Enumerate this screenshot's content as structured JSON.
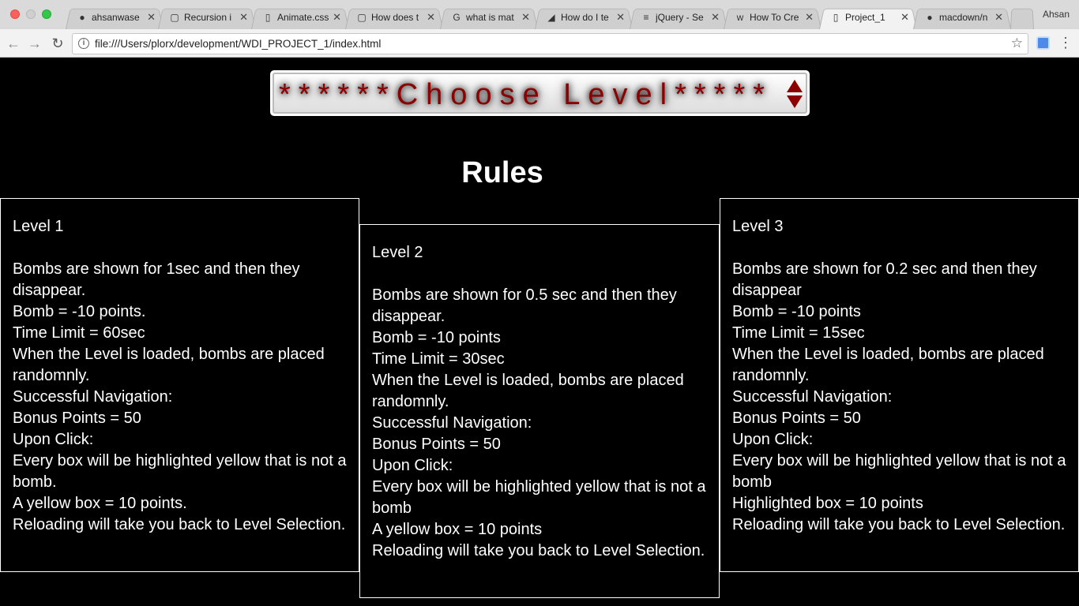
{
  "browser": {
    "tabs": [
      {
        "title": "ahsanwase",
        "icon": "github-icon"
      },
      {
        "title": "Recursion i",
        "icon": "codepen-icon"
      },
      {
        "title": "Animate.css",
        "icon": "page-icon"
      },
      {
        "title": "How does t",
        "icon": "codepen-icon"
      },
      {
        "title": "what is mat",
        "icon": "google-icon"
      },
      {
        "title": "How do I te",
        "icon": "stackexchange-icon"
      },
      {
        "title": "jQuery - Se",
        "icon": "stackoverflow-icon"
      },
      {
        "title": "How To Cre",
        "icon": "w3schools-icon"
      },
      {
        "title": "Project_1",
        "icon": "page-icon"
      },
      {
        "title": "macdown/n",
        "icon": "github-icon"
      }
    ],
    "active_tab": "Project_1",
    "user": "Ahsan",
    "url": "file:///Users/plorx/development/WDI_PROJECT_1/index.html",
    "close_glyph": "✕",
    "info_glyph": "i",
    "star_glyph": "☆",
    "menu_glyph": "⋮",
    "back_glyph": "←",
    "forward_glyph": "→",
    "reload_glyph": "↻"
  },
  "page": {
    "level_select": {
      "selected": "******Choose Level*****"
    },
    "rules_title": "Rules",
    "levels": [
      {
        "heading": "Level 1",
        "lines": [
          "Bombs are shown for 1sec and then they disappear.",
          "Bomb = -10 points.",
          "Time Limit = 60sec",
          "When the Level is loaded, bombs are placed randomnly.",
          "Successful Navigation:",
          "Bonus Points = 50",
          "Upon Click:",
          "Every box will be highlighted yellow that is not a bomb.",
          "A yellow box = 10 points.",
          "Reloading will take you back to Level Selection."
        ]
      },
      {
        "heading": "Level 2",
        "lines": [
          "Bombs are shown for 0.5 sec and then they disappear.",
          "Bomb = -10 points",
          "Time Limit = 30sec",
          "When the Level is loaded, bombs are placed randomnly.",
          "Successful Navigation:",
          "Bonus Points = 50",
          "Upon Click:",
          "Every box will be highlighted yellow that is not a bomb",
          "A yellow box = 10 points",
          "Reloading will take you back to Level Selection."
        ]
      },
      {
        "heading": "Level 3",
        "lines": [
          "Bombs are shown for 0.2 sec and then they disappear",
          "Bomb = -10 points",
          "Time Limit = 15sec",
          "When the Level is loaded, bombs are placed randomnly.",
          "Successful Navigation:",
          "Bonus Points = 50",
          "Upon Click:",
          "Every box will be highlighted yellow that is not a bomb",
          "Highlighted box = 10 points",
          "Reloading will take you back to Level Selection."
        ]
      }
    ]
  }
}
